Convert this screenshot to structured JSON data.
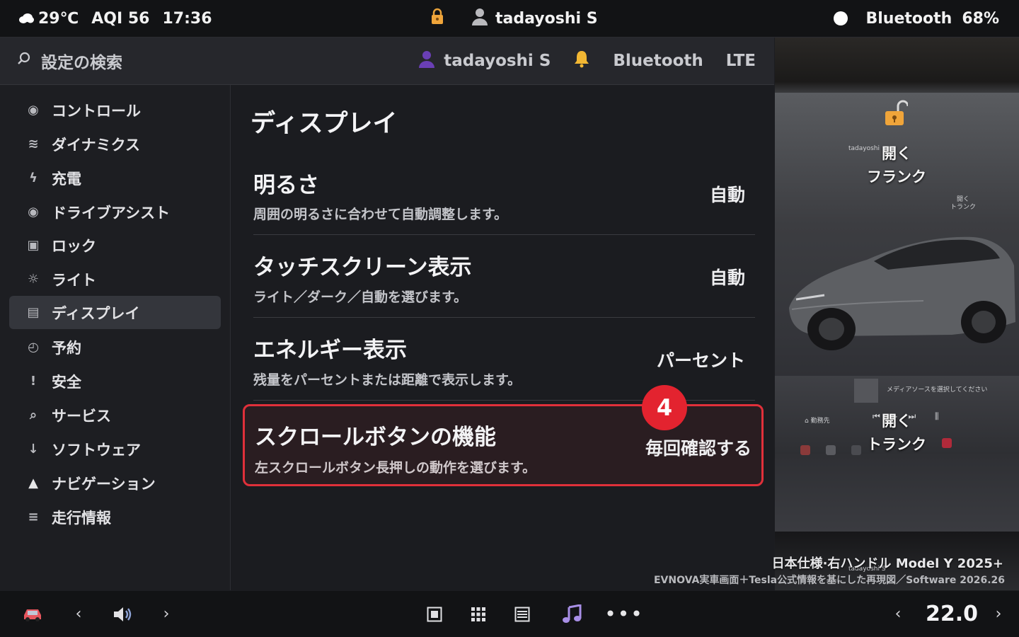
{
  "status": {
    "weather": "29℃",
    "aqi": "AQI 56",
    "time": "17:36",
    "user": "tadayoshi S",
    "bluetooth": "Bluetooth",
    "battery": "68%"
  },
  "header": {
    "search_label": "設定の検索",
    "user": "tadayoshi S",
    "bluetooth": "Bluetooth",
    "network": "LTE"
  },
  "sidebar": {
    "items": [
      {
        "label": "コントロール",
        "icon": "record-icon"
      },
      {
        "label": "ダイナミクス",
        "icon": "wave-icon"
      },
      {
        "label": "充電",
        "icon": "bolt-icon"
      },
      {
        "label": "ドライブアシスト",
        "icon": "record-icon"
      },
      {
        "label": "ロック",
        "icon": "square-icon"
      },
      {
        "label": "ライト",
        "icon": "sun-icon"
      },
      {
        "label": "ディスプレイ",
        "icon": "display-icon"
      },
      {
        "label": "予約",
        "icon": "clock-icon"
      },
      {
        "label": "安全",
        "icon": "exclamation-icon"
      },
      {
        "label": "サービス",
        "icon": "search-icon"
      },
      {
        "label": "ソフトウェア",
        "icon": "download-icon"
      },
      {
        "label": "ナビゲーション",
        "icon": "navigation-icon"
      },
      {
        "label": "走行情報",
        "icon": "menu-icon"
      }
    ],
    "active_index": 6
  },
  "main": {
    "title": "ディスプレイ",
    "rows": [
      {
        "title": "明るさ",
        "desc": "周囲の明るさに合わせて自動調整します。",
        "value": "自動"
      },
      {
        "title": "タッチスクリーン表示",
        "desc": "ライト／ダーク／自動を選びます。",
        "value": "自動"
      },
      {
        "title": "エネルギー表示",
        "desc": "残量をパーセントまたは距離で表示します。",
        "value": "パーセント"
      },
      {
        "title": "スクロールボタンの機能",
        "desc": "左スクロールボタン長押しの動作を選びます。",
        "value": "毎回確認する"
      }
    ],
    "step_badge": "4"
  },
  "photo": {
    "frunk_line1": "開く",
    "frunk_line2": "フランク",
    "trunk_line1": "開く",
    "trunk_line2": "トランク",
    "small_user": "tadayoshi",
    "small_trunk1": "開く",
    "small_trunk2": "トランク",
    "small_media": "メディアソースを選択してください",
    "small_dest": "勤務先",
    "small_user2": "tadayoshi S",
    "caption1": "日本仕様·右ハンドル Model Y 2025+",
    "caption2": "EVNOVA実車画面＋Tesla公式情報を基にした再現図／Software 2026.26"
  },
  "bottom": {
    "temperature": "22.0"
  },
  "colors": {
    "highlight_border": "#e0303a",
    "badge": "#e3232f",
    "active_item": "#34363c"
  }
}
